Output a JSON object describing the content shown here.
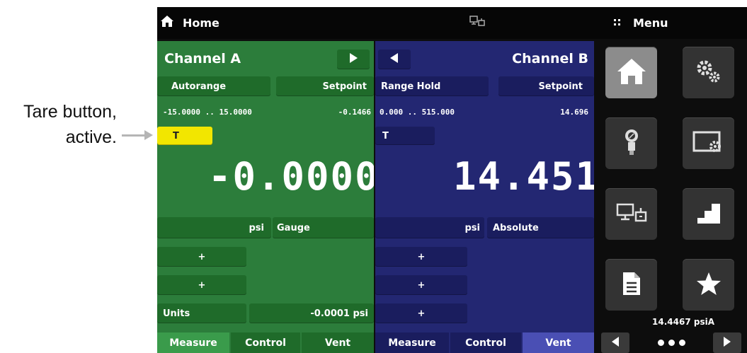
{
  "callout": {
    "line1": "Tare button,",
    "line2": "active."
  },
  "topbar": {
    "title": "Home",
    "menu_label": "Menu"
  },
  "channel_a": {
    "title": "Channel A",
    "autorange_label": "Autorange",
    "setpoint_label": "Setpoint",
    "range_text": "-15.0000 .. 15.0000",
    "setpoint_value": "-0.1466",
    "tare_label": "T",
    "tare_active": true,
    "reading": "-0.0000",
    "unit": "psi",
    "mode": "Gauge",
    "plus1": "+",
    "plus2": "+",
    "units_label": "Units",
    "units_value": "-0.0001 psi",
    "tabs": [
      {
        "label": "Measure",
        "active": true
      },
      {
        "label": "Control",
        "active": false
      },
      {
        "label": "Vent",
        "active": false
      }
    ]
  },
  "channel_b": {
    "title": "Channel B",
    "range_hold_label": "Range Hold",
    "setpoint_label": "Setpoint",
    "range_text": "0.000 .. 515.000",
    "setpoint_value": "14.696",
    "tare_label": "T",
    "tare_active": false,
    "reading": "14.451",
    "unit": "psi",
    "mode": "Absolute",
    "plus1": "+",
    "plus2": "+",
    "plus3": "+",
    "tabs": [
      {
        "label": "Measure",
        "active": false
      },
      {
        "label": "Control",
        "active": false
      },
      {
        "label": "Vent",
        "active": true
      }
    ]
  },
  "menu": {
    "tiles": [
      "home-icon",
      "settings-icon",
      "sensor-icon",
      "display-settings-icon",
      "remote-icon",
      "step-icon",
      "document-icon",
      "favorite-icon"
    ],
    "readout": "14.4467 psiA"
  },
  "colors": {
    "channel_a_bg": "#2c7d3b",
    "channel_b_bg": "#232772",
    "tare_active": "#f2e600",
    "menu_bg": "#0d0d0d"
  }
}
